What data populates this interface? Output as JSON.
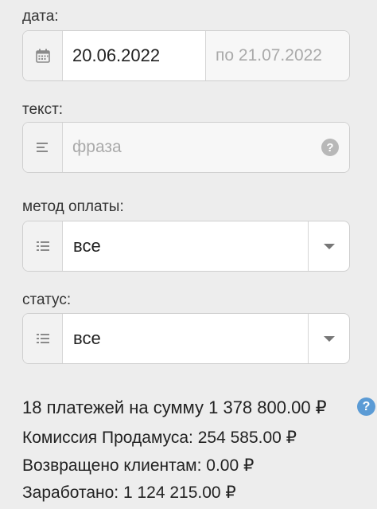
{
  "date": {
    "label": "дата:",
    "from": "20.06.2022",
    "to_placeholder": "по 21.07.2022"
  },
  "text": {
    "label": "текст:",
    "placeholder": "фраза"
  },
  "payment_method": {
    "label": "метод оплаты:",
    "value": "все"
  },
  "status": {
    "label": "статус:",
    "value": "все"
  },
  "summary": {
    "total": "18 платежей на сумму 1 378 800.00 ₽",
    "commission": "Комиссия Продамуса: 254 585.00 ₽",
    "refunded": "Возвращено клиентам: 0.00 ₽",
    "earned": "Заработано: 1 124 215.00 ₽"
  },
  "icons": {
    "help_glyph": "?"
  },
  "colors": {
    "background": "#ededed",
    "help_accent": "#5b9bd5"
  }
}
